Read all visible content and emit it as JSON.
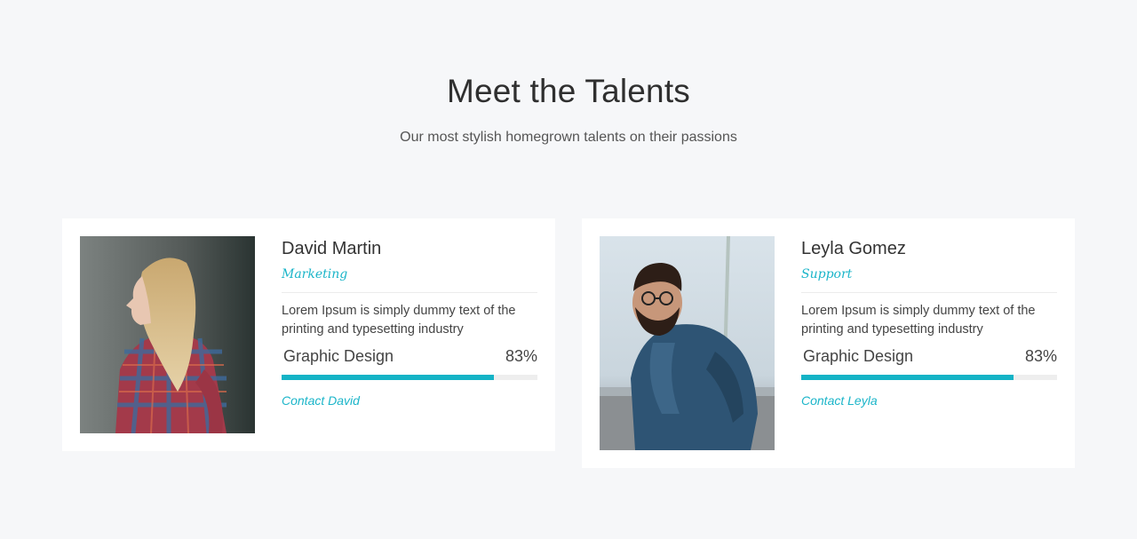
{
  "section": {
    "title": "Meet the Talents",
    "subtitle": "Our most stylish homegrown talents on their passions"
  },
  "colors": {
    "accent": "#14b3c6",
    "background": "#f6f7f9",
    "card": "#ffffff"
  },
  "talents": [
    {
      "name": "David Martin",
      "role": "Marketing",
      "description": "Lorem Ipsum is simply dummy text of the printing and typesetting industry",
      "skill": {
        "name": "Graphic Design",
        "percent_label": "83%",
        "percent": 83
      },
      "contact_label": "Contact David"
    },
    {
      "name": "Leyla Gomez",
      "role": "Support",
      "description": "Lorem Ipsum is simply dummy text of the printing and typesetting industry",
      "skill": {
        "name": "Graphic Design",
        "percent_label": "83%",
        "percent": 83
      },
      "contact_label": "Contact Leyla"
    }
  ]
}
